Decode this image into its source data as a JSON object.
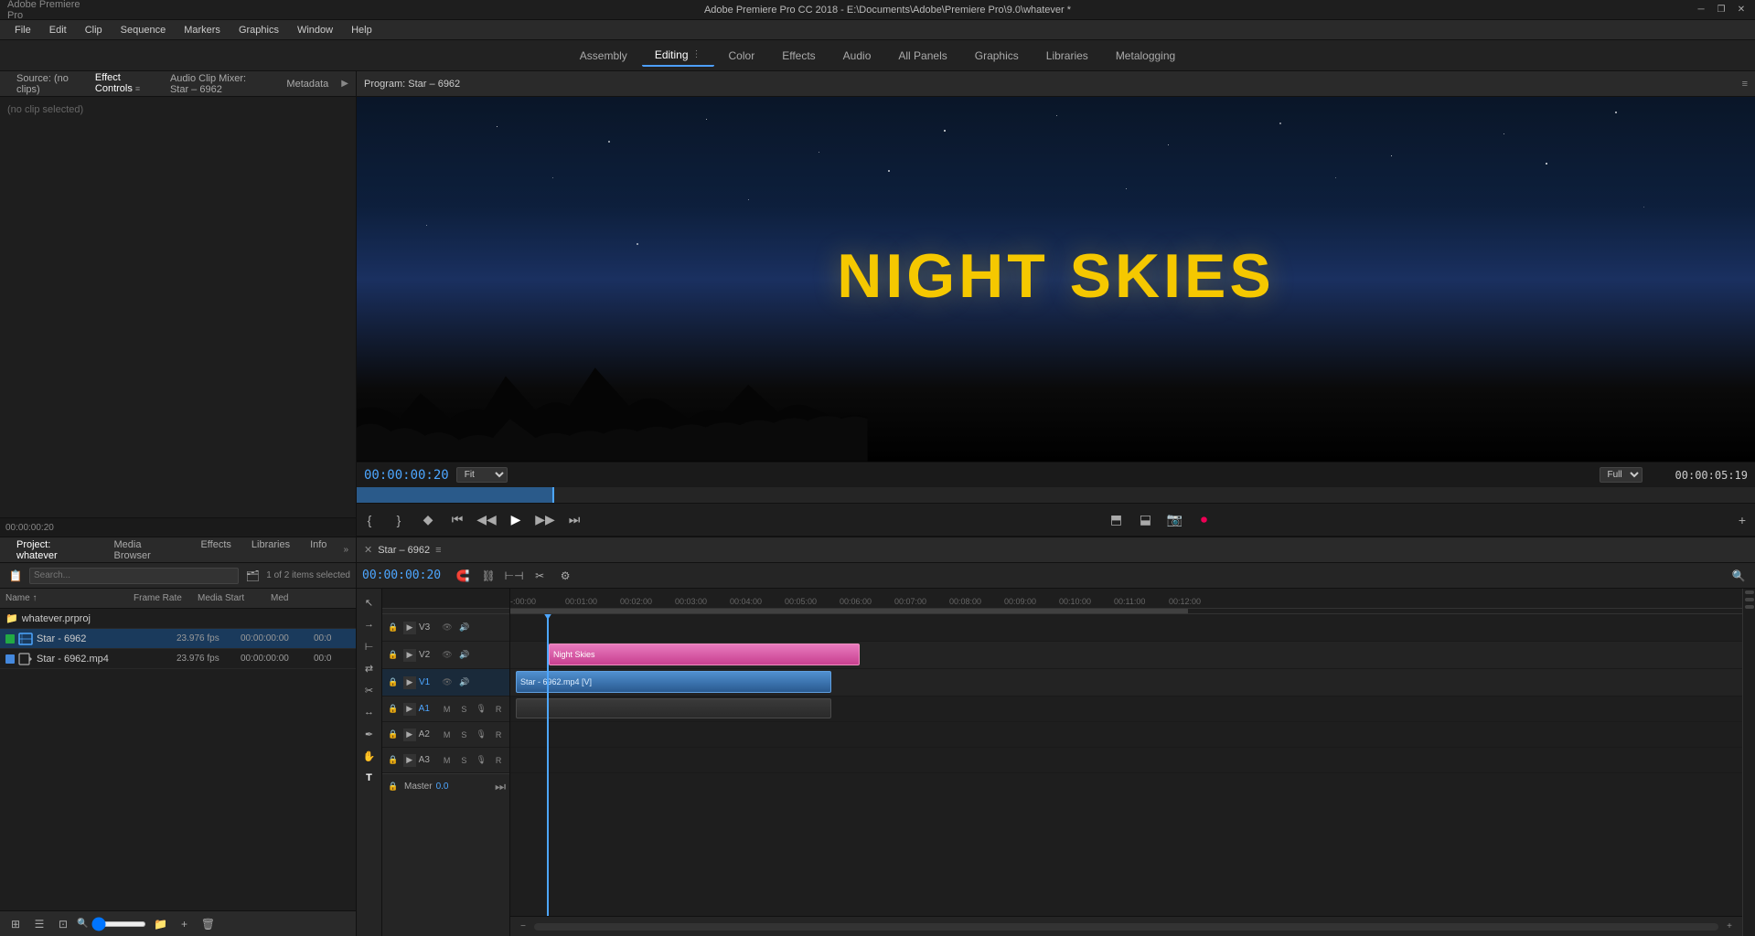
{
  "app": {
    "title": "Adobe Premiere Pro CC 2018 - E:\\Documents\\Adobe\\Premiere Pro\\9.0\\whatever *"
  },
  "window_controls": {
    "minimize": "─",
    "restore": "❐",
    "close": "✕"
  },
  "menu": {
    "items": [
      "File",
      "Edit",
      "Clip",
      "Sequence",
      "Markers",
      "Graphics",
      "Window",
      "Help"
    ]
  },
  "workspace_tabs": [
    {
      "id": "assembly",
      "label": "Assembly"
    },
    {
      "id": "editing",
      "label": "Editing",
      "active": true
    },
    {
      "id": "color",
      "label": "Color"
    },
    {
      "id": "effects",
      "label": "Effects"
    },
    {
      "id": "audio",
      "label": "Audio"
    },
    {
      "id": "all-panels",
      "label": "All Panels"
    },
    {
      "id": "graphics",
      "label": "Graphics"
    },
    {
      "id": "libraries",
      "label": "Libraries"
    },
    {
      "id": "metalogging",
      "label": "Metalogging"
    }
  ],
  "effect_controls": {
    "title": "Effect Controls",
    "tabs": [
      {
        "id": "source",
        "label": "Source: (no clips)"
      },
      {
        "id": "effect-controls",
        "label": "Effect Controls",
        "active": true
      },
      {
        "id": "audio-clip-mixer",
        "label": "Audio Clip Mixer: Star – 6962"
      },
      {
        "id": "metadata",
        "label": "Metadata"
      }
    ],
    "no_clip_msg": "(no clip selected)",
    "timecode": "00:00:00:20"
  },
  "project_panel": {
    "title": "Project: whatever",
    "tabs": [
      {
        "id": "project",
        "label": "Project: whatever"
      },
      {
        "id": "media-browser",
        "label": "Media Browser"
      },
      {
        "id": "effects",
        "label": "Effects"
      },
      {
        "id": "libraries",
        "label": "Libraries"
      },
      {
        "id": "info",
        "label": "Info"
      }
    ],
    "item_count": "1 of 2 items selected",
    "columns": [
      {
        "id": "name",
        "label": "Name"
      },
      {
        "id": "frame-rate",
        "label": "Frame Rate"
      },
      {
        "id": "media-start",
        "label": "Media Start"
      },
      {
        "id": "med",
        "label": "Med"
      }
    ],
    "folder": {
      "name": "whatever.prproj",
      "icon": "folder"
    },
    "items": [
      {
        "id": "star-6962",
        "name": "Star - 6962",
        "type": "sequence",
        "color": "green",
        "frameRate": "23.976 fps",
        "mediaStart": "00:00:00:00",
        "med": "00:0",
        "selected": true
      },
      {
        "id": "star-6962-mp4",
        "name": "Star - 6962.mp4",
        "type": "video",
        "color": "blue",
        "frameRate": "23.976 fps",
        "mediaStart": "00:00:00:00",
        "med": "00:0"
      }
    ],
    "zoom_value": ""
  },
  "program_monitor": {
    "title": "Program: Star – 6962",
    "current_timecode": "00:00:00:20",
    "end_timecode": "00:00:05:19",
    "fit_label": "Fit",
    "quality_label": "Full",
    "video": {
      "title_text": "NIGHT SKIES",
      "title_color": "#f5c800"
    }
  },
  "sequence": {
    "name": "Star – 6962",
    "timecode": "00:00:00:20",
    "tracks": [
      {
        "id": "v3",
        "name": "V3",
        "type": "video"
      },
      {
        "id": "v2",
        "name": "V2",
        "type": "video"
      },
      {
        "id": "v1",
        "name": "V1",
        "type": "video"
      },
      {
        "id": "a1",
        "name": "A1",
        "type": "audio"
      },
      {
        "id": "a2",
        "name": "A2",
        "type": "audio"
      },
      {
        "id": "a3",
        "name": "A3",
        "type": "audio"
      }
    ],
    "clips": [
      {
        "id": "night-skies-clip",
        "name": "Night Skies",
        "track": "v2",
        "type": "graphic",
        "color": "#e060a0"
      },
      {
        "id": "star-6962-clip",
        "name": "Star - 6962.mp4 [V]",
        "track": "v1",
        "type": "video",
        "color": "#3070b0"
      }
    ],
    "master": {
      "label": "Master",
      "volume": "0.0"
    },
    "time_markers": [
      ":00:00",
      "00:01:00",
      "00:02:00",
      "00:03:00",
      "00:04:00",
      "00:05:00",
      "00:06:00",
      "00:07:00",
      "00:08:00",
      "00:09:00",
      "00:10:00",
      "00:11:00",
      "00:12:00"
    ]
  }
}
